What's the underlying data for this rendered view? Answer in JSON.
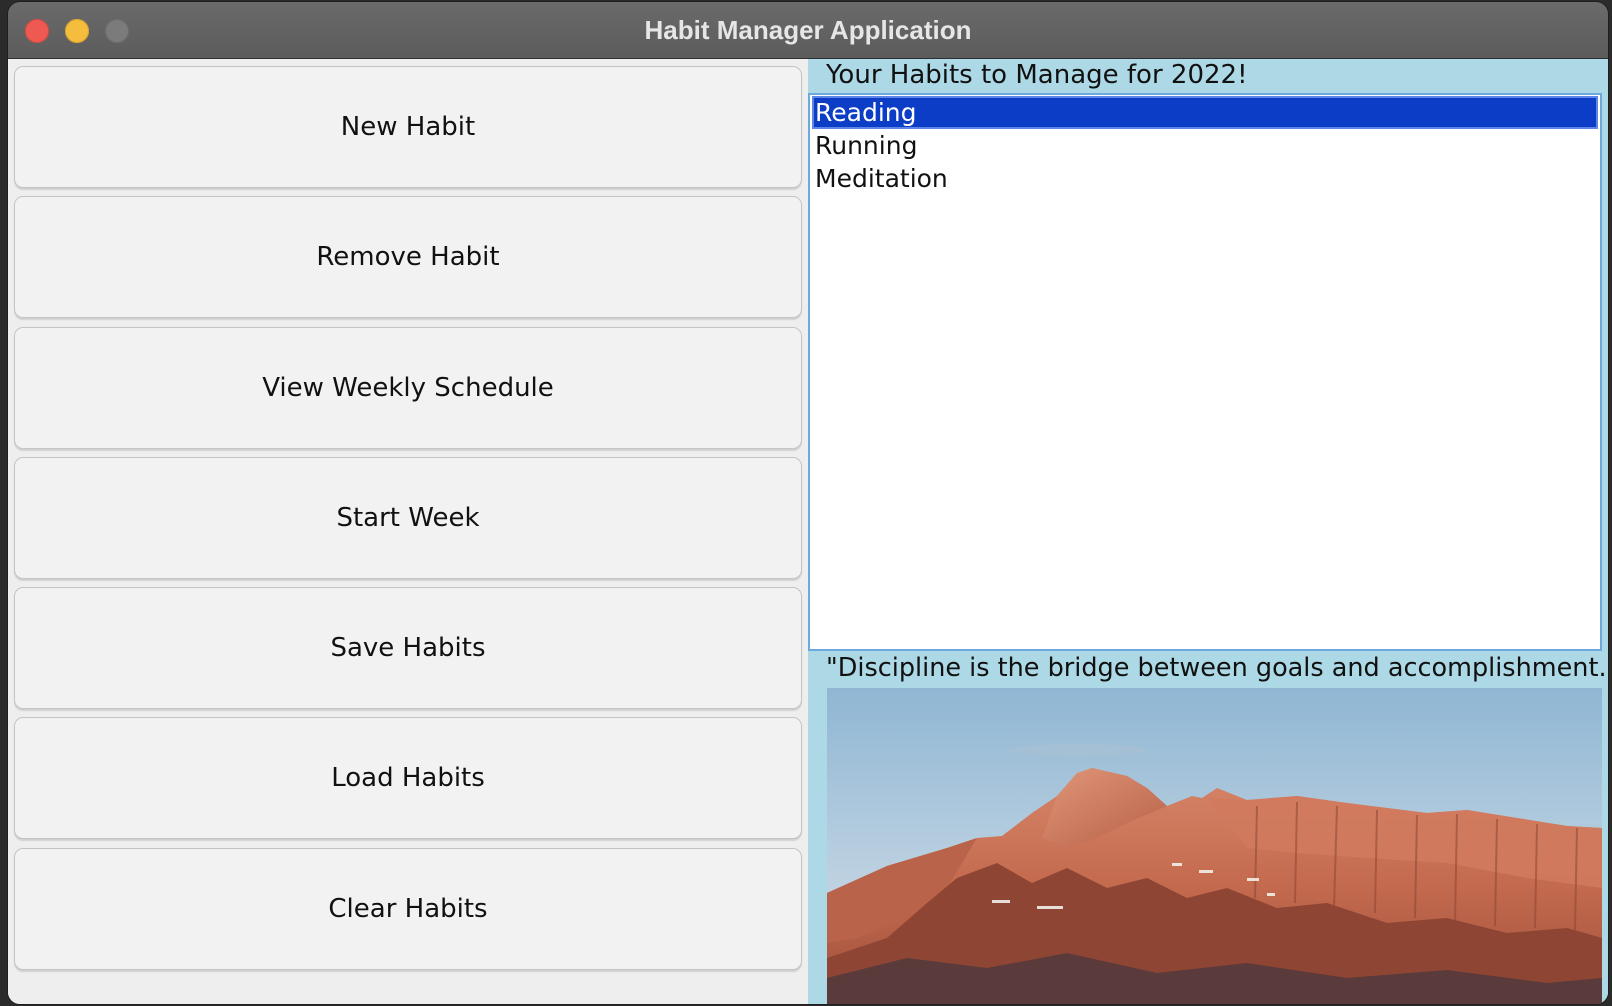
{
  "window": {
    "title": "Habit Manager Application"
  },
  "sidebar": {
    "buttons": [
      {
        "label": "New Habit"
      },
      {
        "label": "Remove Habit"
      },
      {
        "label": "View Weekly Schedule"
      },
      {
        "label": "Start Week"
      },
      {
        "label": "Save Habits"
      },
      {
        "label": "Load Habits"
      },
      {
        "label": "Clear Habits"
      }
    ]
  },
  "habits_panel": {
    "title": "Your Habits to Manage for 2022!",
    "items": [
      {
        "label": "Reading",
        "selected": true
      },
      {
        "label": "Running",
        "selected": false
      },
      {
        "label": "Meditation",
        "selected": false
      }
    ],
    "quote": "\"Discipline is the bridge between goals and accomplishment.\""
  },
  "colors": {
    "panel_background": "#add8e6",
    "selection": "#0b3dc7",
    "close_button": "#ee5a52",
    "minimize_button": "#f4bd3e"
  }
}
